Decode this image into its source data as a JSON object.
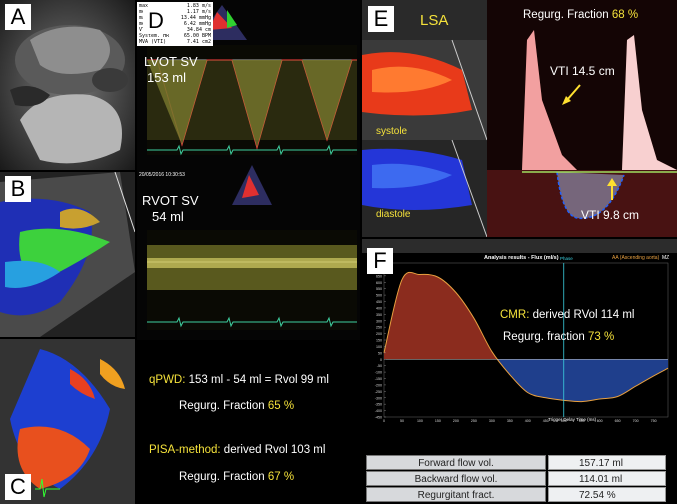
{
  "panels": {
    "a": {
      "label": "A"
    },
    "b": {
      "label": "B"
    },
    "c": {
      "label": "C"
    },
    "d": {
      "label": "D",
      "lvot_title": "LVOT SV",
      "lvot_value": "153 ml",
      "rvot_title": "RVOT SV",
      "rvot_value": "54 ml",
      "info_lines": [
        "max",
        "mean",
        "maxPG",
        "meanPG",
        "VTI",
        "System. HR",
        "MVA (VTI)"
      ],
      "info_values": [
        "1.83 m/s",
        "1.17 m/s",
        "13.44 mmHg",
        "6.42 mmHg",
        "34.84 cm",
        "65.00 BPM",
        "7.41 cm2"
      ],
      "timestamp": "20/05/2016 10:30:53",
      "qpwd_prefix": "qPWD:",
      "qpwd_formula": "153 ml - 54 ml = Rvol 99 ml",
      "qpwd_fraction_label": "Regurg. Fraction",
      "qpwd_fraction_value": "65 %",
      "pisa_prefix": "PISA-method:",
      "pisa_formula": "derived Rvol 103 ml",
      "pisa_fraction_label": "Regurg. Fraction",
      "pisa_fraction_value": "67 %"
    },
    "e": {
      "label": "E",
      "vessel": "LSA",
      "fraction_label": "Regurg. Fraction",
      "fraction_value": "68 %",
      "vti_forward": "VTI 14.5 cm",
      "vti_backward": "VTI 9.8 cm",
      "systole": "systole",
      "diastole": "diastole"
    },
    "f": {
      "label": "F",
      "header": "Analysis results - Flux (ml/s)",
      "legend": "AA (Ascending aorta)",
      "phase": "Phase",
      "corner": "MZ",
      "xlabel": "Trigger Delay Time (ms)",
      "cmr_prefix": "CMR:",
      "cmr_text": "derived RVol 114 ml",
      "cmr_fraction_label": "Regurg. fraction",
      "cmr_fraction_value": "73 %",
      "table": [
        {
          "label": "Forward flow vol.",
          "value": "157.17 ml"
        },
        {
          "label": "Backward flow vol.",
          "value": "114.01 ml"
        },
        {
          "label": "Regurgitant fract.",
          "value": "72.54 %"
        }
      ],
      "colors": {
        "forward": "#8b2c1e",
        "backward": "#1f3f8c",
        "line": "#e8a040"
      }
    }
  },
  "chart_data": {
    "type": "area",
    "x": [
      0,
      50,
      100,
      150,
      200,
      250,
      300,
      350,
      400,
      450,
      500,
      550,
      600,
      650,
      700,
      750,
      790
    ],
    "series": [
      {
        "values": [
          50,
          620,
          660,
          640,
          520,
          320,
          60,
          -120,
          -260,
          -300,
          -320,
          -330,
          -310,
          -290,
          -210,
          -130,
          -70
        ]
      }
    ],
    "xticks": [
      0,
      50,
      100,
      150,
      200,
      250,
      300,
      350,
      400,
      450,
      500,
      550,
      600,
      650,
      700,
      750
    ],
    "yticks": [
      700,
      650,
      600,
      550,
      500,
      450,
      400,
      350,
      300,
      250,
      200,
      150,
      100,
      50,
      0,
      -50,
      -100,
      -150,
      -200,
      -250,
      -300,
      -350,
      -400,
      -450
    ],
    "ylim": [
      -450,
      750
    ],
    "xlim": [
      0,
      790
    ]
  }
}
